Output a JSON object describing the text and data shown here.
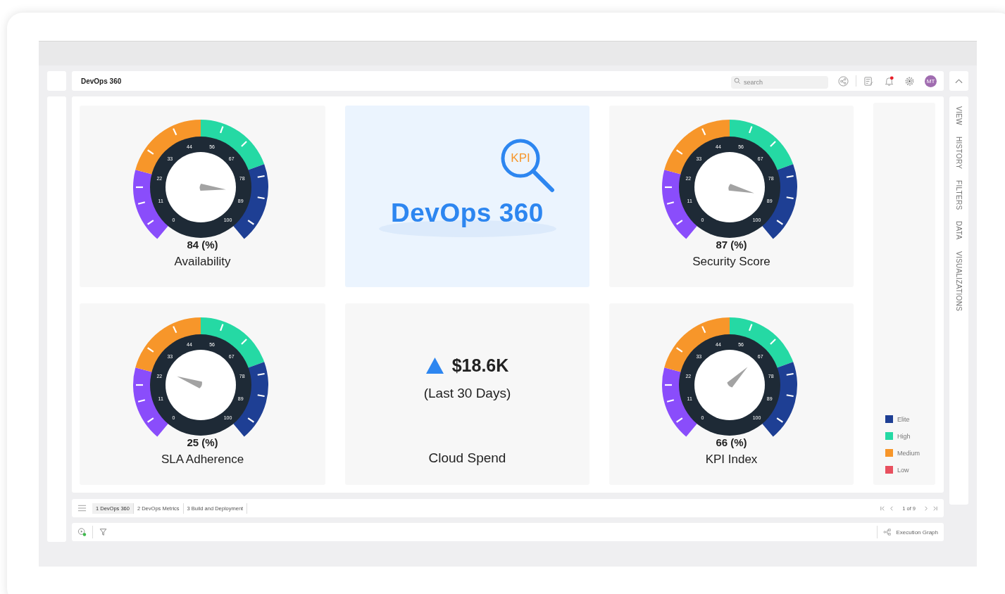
{
  "header": {
    "title": "DevOps 360",
    "search": {
      "placeholder": "search"
    },
    "avatar": "MT"
  },
  "side_tabs": [
    {
      "label": "VIEW"
    },
    {
      "label": "HISTORY"
    },
    {
      "label": "FILTERS"
    },
    {
      "label": "DATA"
    },
    {
      "label": "VISUALIZATIONS"
    }
  ],
  "tiles": [
    {
      "kind": "gauge",
      "value": "84 (%)",
      "label": "Availability",
      "ticks": [
        "0",
        "11",
        "22",
        "33",
        "44",
        "56",
        "67",
        "78",
        "89",
        "100"
      ]
    },
    {
      "kind": "logo",
      "badge": "KPI",
      "title": "DevOps 360"
    },
    {
      "kind": "gauge",
      "value": "87 (%)",
      "label": "Security Score",
      "ticks": [
        "0",
        "11",
        "22",
        "33",
        "44",
        "56",
        "67",
        "78",
        "89",
        "100"
      ]
    },
    {
      "kind": "gauge",
      "value": "25 (%)",
      "label": "SLA Adherence",
      "ticks": [
        "0",
        "11",
        "22",
        "33",
        "44",
        "56",
        "67",
        "78",
        "89",
        "100"
      ]
    },
    {
      "kind": "metric",
      "value": "$18.6K",
      "period": "(Last 30 Days)",
      "label": "Cloud Spend"
    },
    {
      "kind": "gauge",
      "value": "66 (%)",
      "label": "KPI Index",
      "ticks": [
        "0",
        "11",
        "22",
        "33",
        "44",
        "56",
        "67",
        "78",
        "89",
        "100"
      ]
    }
  ],
  "legend": [
    {
      "label": "Elite",
      "color": "#1e3f94"
    },
    {
      "label": "High",
      "color": "#25d9a4"
    },
    {
      "label": "Medium",
      "color": "#f7962a"
    },
    {
      "label": "Low",
      "color": "#e8505f"
    }
  ],
  "page_tabs": [
    {
      "label": "1 DevOps 360",
      "selected": true
    },
    {
      "label": "2 DevOps Metrics",
      "selected": false
    },
    {
      "label": "3 Build and Deployment",
      "selected": false
    }
  ],
  "pagination": "1 of 9",
  "toolbar": {
    "action": "Execution Graph"
  }
}
